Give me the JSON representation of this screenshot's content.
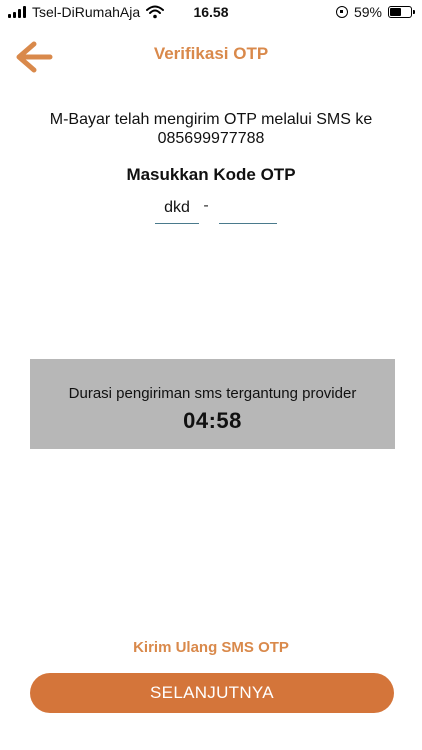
{
  "status_bar": {
    "carrier": "Tsel-DiRumahAja",
    "time": "16.58",
    "battery_percent": "59%",
    "battery_level": 0.59
  },
  "header": {
    "title": "Verifikasi OTP",
    "accent_color": "#d9894b",
    "back_icon": "arrow-left-icon"
  },
  "main": {
    "info_text": "M-Bayar telah mengirim OTP melalui SMS ke 085699977788",
    "otp_label": "Masukkan Kode OTP",
    "otp_prefix_value": "dkd",
    "otp_separator": "-",
    "otp_code_value": ""
  },
  "info_box": {
    "text": "Durasi pengiriman sms tergantung provider",
    "timer": "04:58",
    "background": "#b7b7b7"
  },
  "actions": {
    "resend_label": "Kirim Ulang SMS OTP",
    "next_label": "SELANJUTNYA",
    "button_color": "#d4753a"
  }
}
